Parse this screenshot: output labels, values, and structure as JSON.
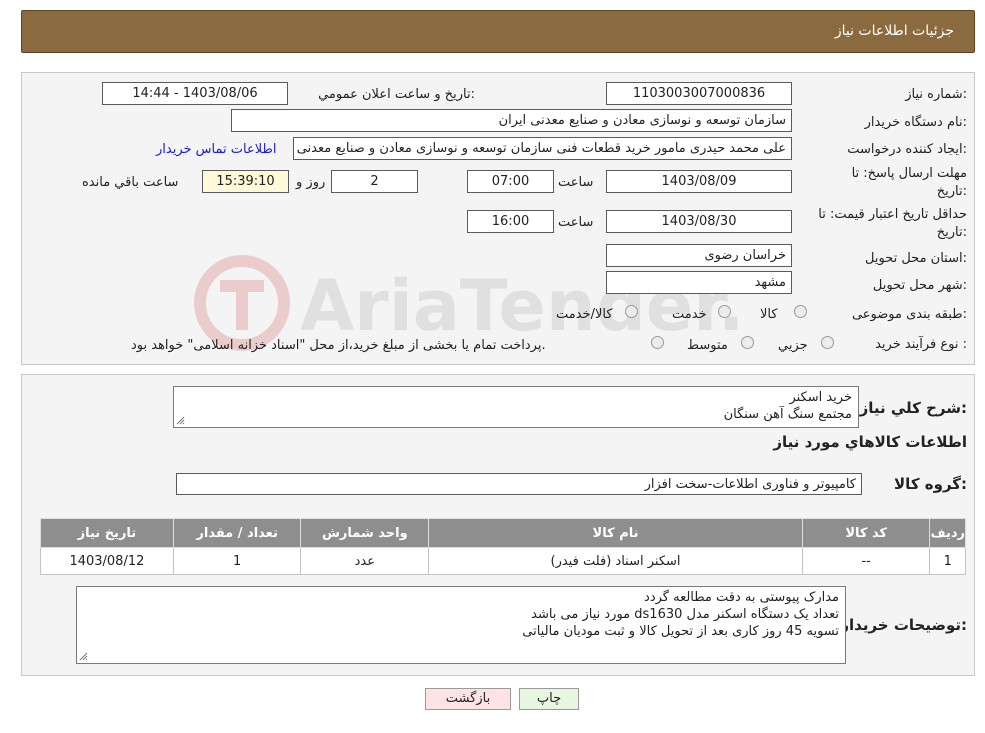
{
  "header": {
    "title": "جزئيات اطلاعات نياز"
  },
  "form": {
    "need_number_label": "شماره نياز:",
    "need_number": "1103003007000836",
    "announce_label": "تاريخ و ساعت اعلان عمومي:",
    "announce_value": "1403/08/06 - 14:44",
    "buyer_org_label": "نام دستگاه خريدار:",
    "buyer_org": "سازمان توسعه و نوسازی معادن و صنایع معدنی ایران",
    "creator_label": "ايجاد کننده درخواست:",
    "creator": "علی محمد حیدری مامور خرید قطعات فنی سازمان توسعه و نوسازی معادن و صنایع معدنی ایران",
    "contact_link": "اطلاعات تماس خريدار",
    "deadline_label_1": "مهلت ارسال پاسخ: تا",
    "deadline_label_2": "تاريخ:",
    "deadline_date": "1403/08/09",
    "time_word": "ساعت",
    "deadline_time": "07:00",
    "days_value": "2",
    "day_and": "روز و",
    "remaining_time": "15:39:10",
    "remaining_label": "ساعت باقي مانده",
    "validity_label_1": "حداقل تاريخ اعتبار قيمت: تا",
    "validity_label_2": "تاريخ:",
    "validity_date": "1403/08/30",
    "validity_time": "16:00",
    "province_label": "استان محل تحويل:",
    "province": "خراسان رضوی",
    "city_label": "شهر محل تحويل:",
    "city": "مشهد",
    "category_label": "طبقه بندی موضوعی:",
    "category_opt1": "کالا",
    "category_opt2": "خدمت",
    "category_opt3": "کالا/خدمت",
    "process_label": "نوع فرآيند خريد :",
    "process_opt1": "جزيي",
    "process_opt2": "متوسط",
    "process_note": "پرداخت تمام يا بخشی از مبلغ خريد،از محل \"اسناد خزانه اسلامی\" خواهد بود."
  },
  "need": {
    "summary_label": "شرح کلي نياز:",
    "summary_line1": "خرید اسکنر",
    "summary_line2": "مجتمع سنگ آهن سنگان",
    "goods_section_title": "اطلاعات کالاهاي مورد نياز",
    "group_label": "گروه کالا:",
    "group_value": "کامپیوتر و فناوری اطلاعات-سخت افزار"
  },
  "table": {
    "headers": [
      "رديف",
      "کد کالا",
      "نام کالا",
      "واحد شمارش",
      "تعداد / مقدار",
      "تاريخ نياز"
    ],
    "rows": [
      [
        "1",
        "--",
        "اسکنر اسناد (فلت فیدر)",
        "عدد",
        "1",
        "1403/08/12"
      ]
    ]
  },
  "buyer_notes": {
    "label": "توضيحات خريدار:",
    "line1": "مدارک پیوستی به دقت مطالعه گردد",
    "line2": "تعداد یک دستگاه اسکنر مدل ds1630 مورد نیاز می باشد",
    "line3": "تسویه 45 روز کاری بعد از تحویل کالا و ثبت مودیان مالیاتی"
  },
  "buttons": {
    "print": "چاپ",
    "back": "بازگشت"
  },
  "watermark_text": "AriaTender.neT",
  "colors": {
    "header_bg": "#8b6a3f",
    "table_header_bg": "#8e8e8e",
    "back_button_bg": "#fde3e3",
    "print_button_bg": "#e6f6e0",
    "highlight_bg": "#fff9d9"
  }
}
